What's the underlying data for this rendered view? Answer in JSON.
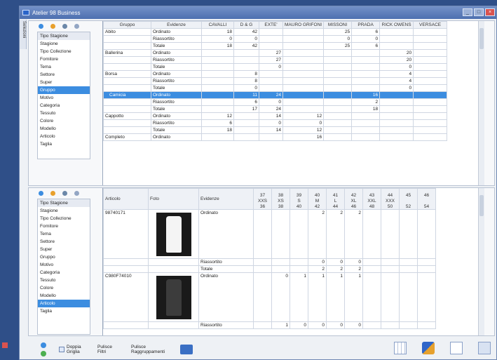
{
  "window": {
    "title": "Atelier 98 Business",
    "side_tab": "Selezioni"
  },
  "filters_top": [
    "Tipo Stagione",
    "Stagione",
    "Tipo Collezione",
    "Fornitore",
    "Tema",
    "Settore",
    "Super",
    "Gruppo",
    "Motivo",
    "Categoria",
    "Tessuto",
    "Colore",
    "Modello",
    "Articolo",
    "Taglia"
  ],
  "filters_top_selected": "Gruppo",
  "filters_bottom": [
    "Tipo Stagione",
    "Stagione",
    "Tipo Collezione",
    "Fornitore",
    "Tema",
    "Settore",
    "Super",
    "Gruppo",
    "Motivo",
    "Categoria",
    "Tessuto",
    "Colore",
    "Modello",
    "Articolo",
    "Taglia"
  ],
  "filters_bottom_selected": "Articolo",
  "grid1": {
    "headers": [
      "Gruppo",
      "Evidenze",
      "CAVALLI",
      "D & G",
      "EXTE'",
      "MAURO GRIFONI",
      "MISSONI",
      "PRADA",
      "RICK OWENS",
      "VERSACE"
    ],
    "rows": [
      {
        "g": "Abito",
        "e": "Ordinato",
        "v": [
          "18",
          "42",
          "",
          "",
          "25",
          "6",
          "",
          ""
        ]
      },
      {
        "g": "",
        "e": "Riassortito",
        "v": [
          "0",
          "0",
          "",
          "",
          "0",
          "0",
          "",
          ""
        ]
      },
      {
        "g": "",
        "e": "Totale",
        "v": [
          "18",
          "42",
          "",
          "",
          "25",
          "6",
          "",
          ""
        ]
      },
      {
        "g": "Ballerina",
        "e": "Ordinato",
        "v": [
          "",
          "",
          "27",
          "",
          "",
          "",
          "20",
          ""
        ]
      },
      {
        "g": "",
        "e": "Riassortito",
        "v": [
          "",
          "",
          "27",
          "",
          "",
          "",
          "20",
          ""
        ]
      },
      {
        "g": "",
        "e": "Totale",
        "v": [
          "",
          "",
          "0",
          "",
          "",
          "",
          "0",
          ""
        ]
      },
      {
        "g": "Borsa",
        "e": "Ordinato",
        "v": [
          "",
          "8",
          "",
          "",
          "",
          "",
          "4",
          ""
        ]
      },
      {
        "g": "",
        "e": "Riassortito",
        "v": [
          "",
          "8",
          "",
          "",
          "",
          "",
          "4",
          ""
        ]
      },
      {
        "g": "",
        "e": "Totale",
        "v": [
          "",
          "0",
          "",
          "",
          "",
          "",
          "0",
          ""
        ]
      },
      {
        "g": "Camicia",
        "e": "Ordinato",
        "v": [
          "",
          "11",
          "24",
          "",
          "",
          "16",
          "",
          ""
        ],
        "sel": true
      },
      {
        "g": "",
        "e": "Riassortito",
        "v": [
          "",
          "6",
          "0",
          "",
          "",
          "2",
          "",
          ""
        ]
      },
      {
        "g": "",
        "e": "Totale",
        "v": [
          "",
          "17",
          "24",
          "",
          "",
          "18",
          "",
          ""
        ]
      },
      {
        "g": "Cappotto",
        "e": "Ordinato",
        "v": [
          "12",
          "",
          "14",
          "12",
          "",
          "",
          "",
          ""
        ]
      },
      {
        "g": "",
        "e": "Riassortito",
        "v": [
          "6",
          "",
          "0",
          "0",
          "",
          "",
          "",
          ""
        ]
      },
      {
        "g": "",
        "e": "Totale",
        "v": [
          "18",
          "",
          "14",
          "12",
          "",
          "",
          "",
          ""
        ]
      },
      {
        "g": "Completo",
        "e": "Ordinato",
        "v": [
          "",
          "",
          "",
          "16",
          "",
          "",
          "",
          ""
        ]
      }
    ]
  },
  "grid2": {
    "headers": [
      "Articolo",
      "Foto",
      "Evidenze"
    ],
    "sizes": [
      [
        "37",
        "XXS",
        "36"
      ],
      [
        "38",
        "XS",
        "38"
      ],
      [
        "39",
        "S",
        "40"
      ],
      [
        "40",
        "M",
        "42"
      ],
      [
        "41",
        "L",
        "44"
      ],
      [
        "42",
        "XL",
        "46"
      ],
      [
        "43",
        "XXL",
        "48"
      ],
      [
        "44",
        "XXX",
        "50"
      ],
      [
        "45",
        "",
        "52"
      ],
      [
        "46",
        "",
        "54"
      ]
    ],
    "articles": [
      {
        "code": "98740171",
        "rows": [
          {
            "e": "Ordinato",
            "v": [
              "",
              "",
              "",
              "2",
              "2",
              "2",
              "",
              "",
              "",
              ""
            ]
          },
          {
            "e": "Riassortito",
            "v": [
              "",
              "",
              "",
              "0",
              "0",
              "0",
              "",
              "",
              "",
              ""
            ]
          },
          {
            "e": "Totale",
            "v": [
              "",
              "",
              "",
              "2",
              "2",
              "2",
              "",
              "",
              "",
              ""
            ]
          }
        ]
      },
      {
        "code": "C980F74010",
        "rows": [
          {
            "e": "Ordinato",
            "v": [
              "",
              "0",
              "1",
              "1",
              "1",
              "1",
              "",
              "",
              "",
              ""
            ]
          },
          {
            "e": "Riassortito",
            "v": [
              "",
              "1",
              "0",
              "0",
              "0",
              "0",
              "",
              "",
              "",
              ""
            ]
          }
        ]
      }
    ]
  },
  "bottombar": {
    "doppia_griglia": "Doppia Griglia",
    "pulisce_filtri": "Pulisce Filtri",
    "pulisce_raggruppamenti": "Pulisce Raggruppamenti"
  }
}
